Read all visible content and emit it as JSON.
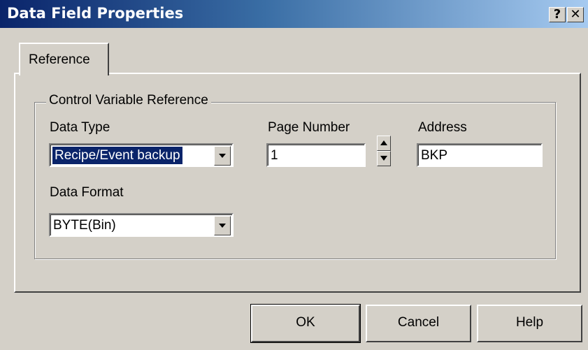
{
  "window": {
    "title": "Data Field Properties",
    "help_button": "?",
    "close_button": "✕"
  },
  "tabs": [
    {
      "label": "Reference"
    }
  ],
  "group": {
    "title": "Control Variable Reference",
    "data_type": {
      "label": "Data Type",
      "value": "Recipe/Event backup"
    },
    "page_number": {
      "label": "Page Number",
      "value": "1"
    },
    "address": {
      "label": "Address",
      "value": "BKP"
    },
    "data_format": {
      "label": "Data Format",
      "value": "BYTE(Bin)"
    }
  },
  "buttons": {
    "ok": "OK",
    "cancel": "Cancel",
    "help": "Help"
  },
  "colors": {
    "titlebar_start": "#0a246a",
    "titlebar_end": "#a6caf0",
    "face": "#d4d0c8",
    "selection": "#0a246a"
  }
}
